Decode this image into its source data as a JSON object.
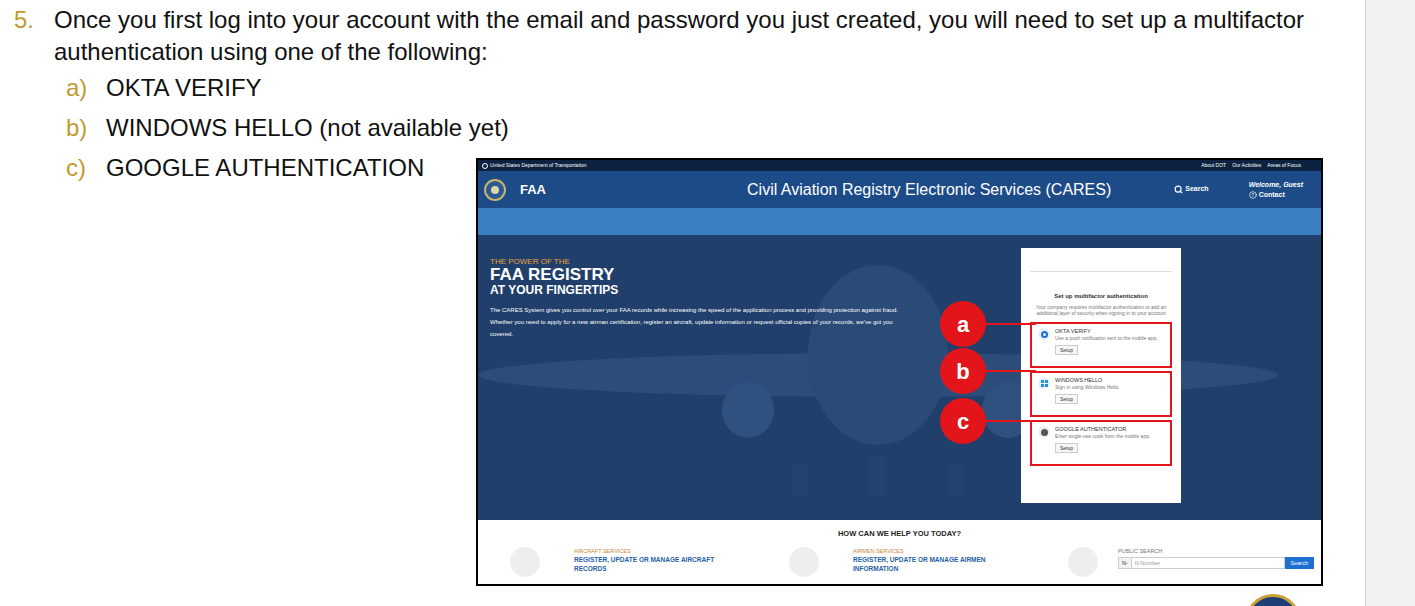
{
  "step": {
    "number": "5.",
    "text": "Once you first log into your account with the email and password you just created, you will need to set up a multifactor authentication using one of the following:"
  },
  "options": [
    {
      "letter": "a)",
      "label": "OKTA VERIFY"
    },
    {
      "letter": "b)",
      "label": "WINDOWS HELLO (not available yet)"
    },
    {
      "letter": "c)",
      "label": "GOOGLE AUTHENTICATION"
    }
  ],
  "screenshot": {
    "top_bar": {
      "agency": "United States Department of Transportation",
      "links": [
        "About DOT",
        "Our Activities",
        "Areas of Focus"
      ]
    },
    "header": {
      "brand": "FAA",
      "title": "Civil Aviation Registry Electronic Services (CARES)",
      "search": "Search",
      "welcome": "Welcome, Guest",
      "contact": "Contact"
    },
    "hero": {
      "kicker": "THE POWER OF THE",
      "title": "FAA REGISTRY",
      "subtitle": "AT YOUR FINGERTIPS",
      "body": "The CARES System gives you control over your FAA records while increasing the speed of the application process and providing protection against fraud. Whether you need to apply for a new airman certification, register an aircraft, update information or request official copies of your records, we've got you covered."
    },
    "mfa": {
      "title": "Set up multifactor authentication",
      "description": "Your company requires multifactor authentication to add an additional layer of security when signing in to your account",
      "factors": [
        {
          "kind": "okta",
          "name": "OKTA VERIFY",
          "description": "Use a push notification sent to the mobile app.",
          "button": "Setup"
        },
        {
          "kind": "windows",
          "name": "WINDOWS HELLO",
          "description": "Sign in using Windows Hello.",
          "button": "Setup"
        },
        {
          "kind": "google",
          "name": "GOOGLE AUTHENTICATOR",
          "description": "Enter single-use code from the mobile app.",
          "button": "Setup"
        }
      ]
    },
    "callouts": [
      "a",
      "b",
      "c"
    ],
    "help": {
      "title": "HOW CAN WE HELP YOU TODAY?",
      "services": [
        {
          "category": "AIRCRAFT SERVICES",
          "link": "REGISTER, UPDATE OR MANAGE AIRCRAFT RECORDS"
        },
        {
          "category": "AIRMEN SERVICES",
          "link": "REGISTER, UPDATE OR MANAGE AIRMEN INFORMATION"
        }
      ],
      "public_search": {
        "category": "PUBLIC SEARCH",
        "prefix": "N-",
        "placeholder": "N-Number",
        "button": "Search"
      }
    }
  }
}
